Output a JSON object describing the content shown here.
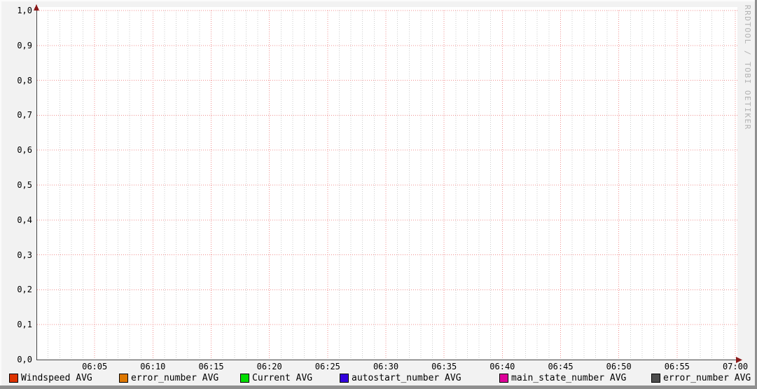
{
  "colors": {
    "background": "#f2f2f2",
    "plot_background": "#ffffff",
    "major_grid": "#f09090",
    "minor_grid": "#cccccc",
    "axis": "#444444",
    "arrow": "#8b1a1a",
    "tick_text": "#000000",
    "watermark_text": "#b3b3b3"
  },
  "chart_data": {
    "type": "line",
    "title": "",
    "xlabel": "",
    "ylabel": "",
    "ylim": [
      0.0,
      1.0
    ],
    "y_tick_step": 0.1,
    "y_ticks": [
      "1,0",
      "0,9",
      "0,8",
      "0,7",
      "0,6",
      "0,5",
      "0,4",
      "0,3",
      "0,2",
      "0,1",
      "0,0"
    ],
    "x_range_minutes": 60,
    "x_start": "06:00",
    "x_end": "07:00",
    "x_ticks": [
      "06:05",
      "06:10",
      "06:15",
      "06:20",
      "06:25",
      "06:30",
      "06:35",
      "06:40",
      "06:45",
      "06:50",
      "06:55",
      "07:00"
    ],
    "minor_x_tick_interval_minutes": 1,
    "grid": {
      "major_style": "dotted red",
      "minor_style": "dotted gray",
      "minor_horizontal": false
    },
    "legend_position": "bottom",
    "series": [
      {
        "name": "Windspeed AVG",
        "color": "#dd3300",
        "values": []
      },
      {
        "name": "error_number AVG",
        "color": "#dd7700",
        "values": []
      },
      {
        "name": "Current AVG",
        "color": "#00dd00",
        "values": []
      },
      {
        "name": "autostart_number AVG",
        "color": "#3300dd",
        "values": []
      },
      {
        "name": "main_state_number AVG",
        "color": "#dd0099",
        "values": []
      },
      {
        "name": "error_number AVG",
        "color": "#4d4d4d",
        "values": []
      }
    ],
    "note": "no data lines plotted (empty graph)",
    "watermark": "RRDTOOL / TOBI OETIKER"
  }
}
